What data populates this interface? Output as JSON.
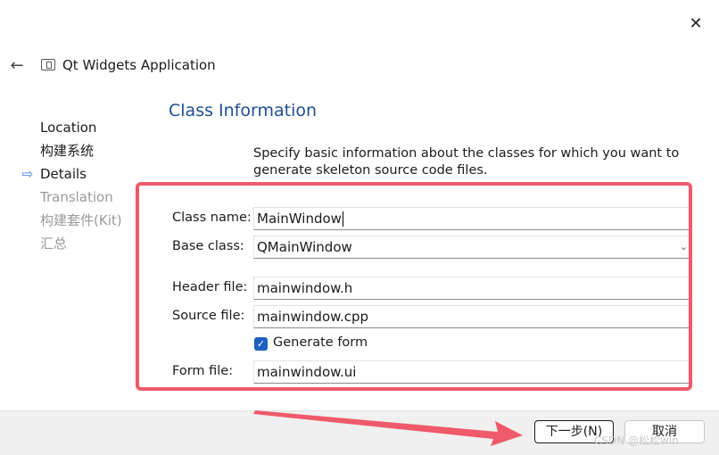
{
  "window": {
    "close_glyph": "✕"
  },
  "header": {
    "back_glyph": "←",
    "app_icon": "window-icon",
    "title": "Qt Widgets Application"
  },
  "steps": [
    {
      "label": "Location",
      "state": "done"
    },
    {
      "label": "构建系统",
      "state": "done"
    },
    {
      "label": "Details",
      "state": "active"
    },
    {
      "label": "Translation",
      "state": "pending"
    },
    {
      "label": "构建套件(Kit)",
      "state": "pending"
    },
    {
      "label": "汇总",
      "state": "pending"
    }
  ],
  "active_step_glyph": "⇨",
  "page": {
    "title": "Class Information",
    "description": "Specify basic information about the classes for which you want to generate skeleton source code files."
  },
  "form": {
    "class_name_label": "Class name:",
    "class_name_value": "MainWindow",
    "base_class_label": "Base class:",
    "base_class_value": "QMainWindow",
    "header_file_label": "Header file:",
    "header_file_value": "mainwindow.h",
    "source_file_label": "Source file:",
    "source_file_value": "mainwindow.cpp",
    "generate_form_label": "Generate form",
    "generate_form_checked": true,
    "form_file_label": "Form file:",
    "form_file_value": "mainwindow.ui"
  },
  "buttons": {
    "next": "下一步(N)",
    "cancel": "取消"
  },
  "annotations": {
    "highlight_color": "#ef5a6a",
    "arrow_color": "#ef5a6a"
  },
  "watermark": "CSDN @松松win",
  "colors": {
    "accent": "#1f5fbf",
    "page_title": "#1f4e91"
  }
}
